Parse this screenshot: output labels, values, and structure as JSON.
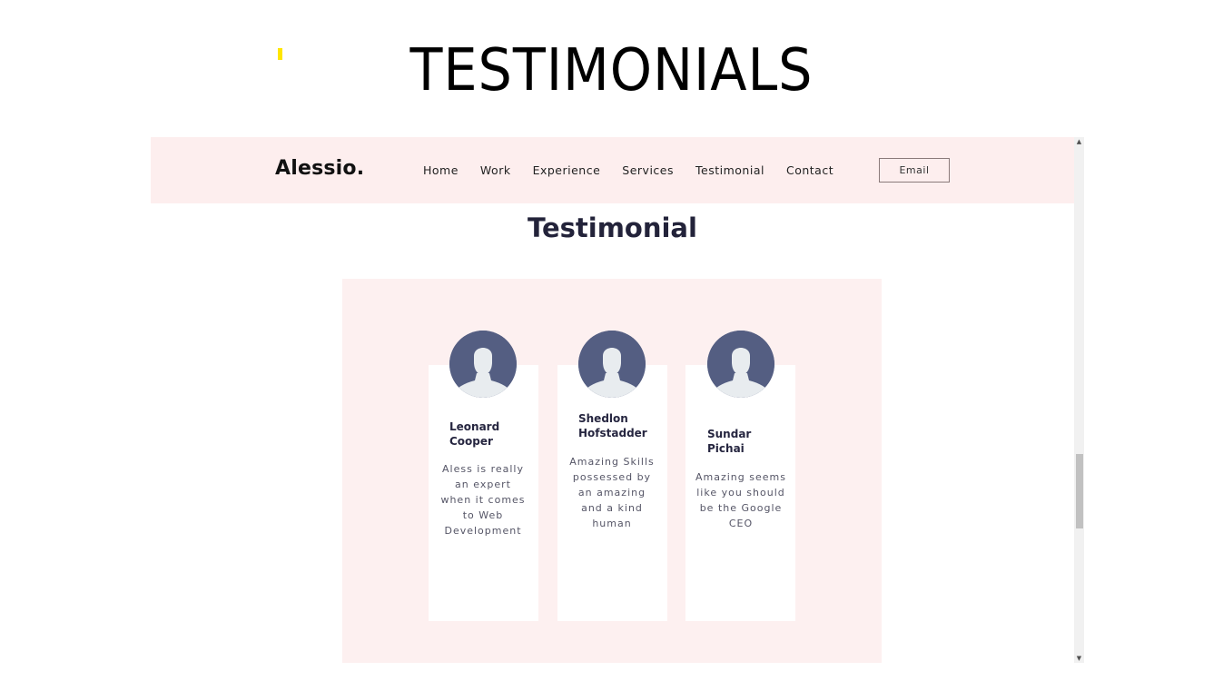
{
  "slide": {
    "title": "TESTIMONIALS",
    "accent_color": "#ffe600"
  },
  "site": {
    "brand": "Alessio.",
    "nav": [
      {
        "label": "Home"
      },
      {
        "label": "Work"
      },
      {
        "label": "Experience"
      },
      {
        "label": "Services"
      },
      {
        "label": "Testimonial"
      },
      {
        "label": "Contact"
      }
    ],
    "email_button": "Email",
    "header_bg": "#fdeeee",
    "section_heading": "Testimonial",
    "testimonials": [
      {
        "name": "Leonard Cooper",
        "avatar_icon": "user-silhouette-icon",
        "quote": "Aless is really an expert when it comes to Web Development"
      },
      {
        "name": "Shedlon Hofstadder",
        "avatar_icon": "user-silhouette-icon",
        "quote": "Amazing Skills possessed by an amazing and a kind human"
      },
      {
        "name": "Sundar Pichai",
        "avatar_icon": "user-silhouette-icon",
        "quote": "Amazing seems like you should be the Google CEO"
      }
    ]
  },
  "scrollbar": {
    "up_icon": "scroll-up-arrow-icon",
    "down_icon": "scroll-down-arrow-icon"
  }
}
